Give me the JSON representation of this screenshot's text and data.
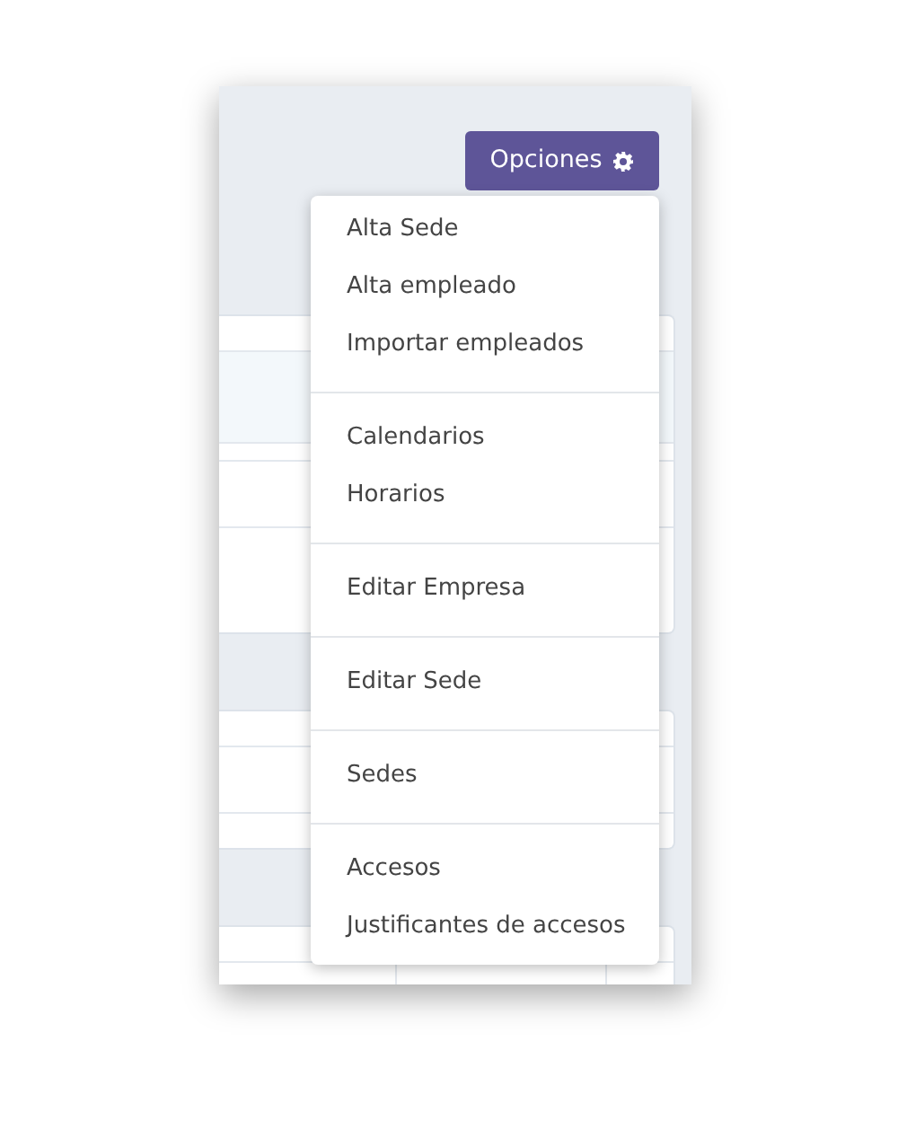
{
  "options_button": {
    "label": "Opciones"
  },
  "menu": {
    "groups": [
      [
        "Alta Sede",
        "Alta empleado",
        "Importar empleados"
      ],
      [
        "Calendarios",
        "Horarios"
      ],
      [
        "Editar Empresa"
      ],
      [
        "Editar Sede"
      ],
      [
        "Sedes"
      ],
      [
        "Accesos",
        "Justificantes de accesos"
      ]
    ]
  }
}
